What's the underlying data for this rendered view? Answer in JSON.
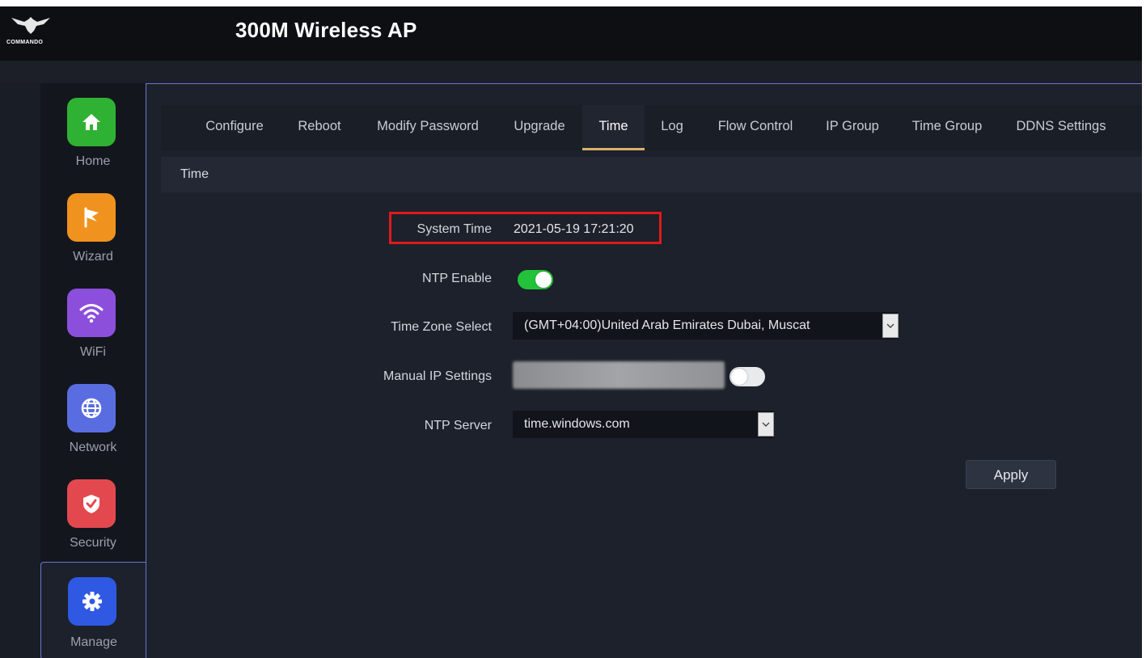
{
  "app": {
    "title": "300M Wireless AP",
    "logo_text": "COMMANDO"
  },
  "sidebar": {
    "items": [
      {
        "label": "Home",
        "icon": "home-icon",
        "color": "#2fb233"
      },
      {
        "label": "Wizard",
        "icon": "flag-icon",
        "color": "#f0921e"
      },
      {
        "label": "WiFi",
        "icon": "wifi-icon",
        "color": "#8c4fdc"
      },
      {
        "label": "Network",
        "icon": "globe-icon",
        "color": "#5a6de0"
      },
      {
        "label": "Security",
        "icon": "shield-icon",
        "color": "#e4484f"
      },
      {
        "label": "Manage",
        "icon": "gear-icon",
        "color": "#2f59e3"
      }
    ],
    "active": "Manage"
  },
  "tabs": {
    "items": [
      "Configure",
      "Reboot",
      "Modify Password",
      "Upgrade",
      "Time",
      "Log",
      "Flow Control",
      "IP Group",
      "Time Group",
      "DDNS Settings"
    ],
    "active": "Time"
  },
  "section": {
    "title": "Time"
  },
  "form": {
    "system_time_label": "System Time",
    "system_time_value": "2021-05-19 17:21:20",
    "ntp_enable_label": "NTP Enable",
    "ntp_enable_on": true,
    "timezone_label": "Time Zone Select",
    "timezone_value": "(GMT+04:00)United Arab Emirates Dubai, Muscat",
    "manual_ip_label": "Manual IP Settings",
    "manual_ip_on": false,
    "ntp_server_label": "NTP Server",
    "ntp_server_value": "time.windows.com"
  },
  "actions": {
    "apply_label": "Apply"
  },
  "colors": {
    "accent": "#d9b26a",
    "toggle_on": "#22c33a",
    "highlight": "#e01a1a",
    "border": "#6d76d3"
  }
}
